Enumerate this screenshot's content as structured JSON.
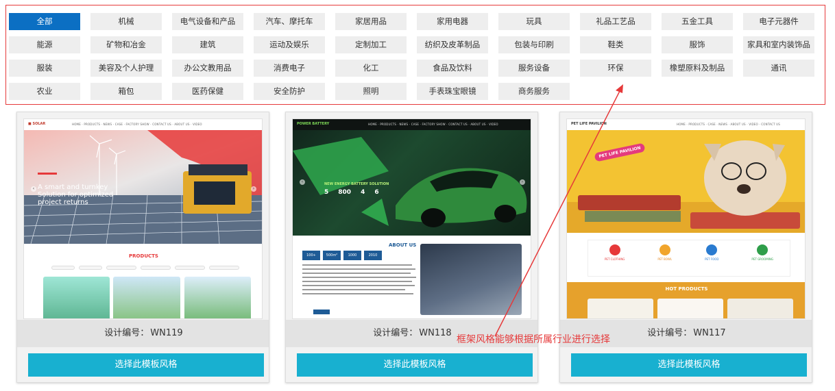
{
  "categories": {
    "active_index": 0,
    "items": [
      "全部",
      "机械",
      "电气设备和产品",
      "汽车、摩托车",
      "家居用品",
      "家用电器",
      "玩具",
      "礼品工艺品",
      "五金工具",
      "电子元器件",
      "能源",
      "矿物和冶金",
      "建筑",
      "运动及娱乐",
      "定制加工",
      "纺织及皮革制品",
      "包装与印刷",
      "鞋类",
      "服饰",
      "家具和室内装饰品",
      "服装",
      "美容及个人护理",
      "办公文教用品",
      "消费电子",
      "化工",
      "食品及饮料",
      "服务设备",
      "环保",
      "橡塑原料及制品",
      "通讯",
      "农业",
      "箱包",
      "医药保健",
      "安全防护",
      "照明",
      "手表珠宝眼镜",
      "商务服务"
    ]
  },
  "templates": [
    {
      "code_label": "设计编号：",
      "code": "WN119",
      "select_label": "选择此模板风格",
      "preview": {
        "hero_text": "A smart and turnkey Solution for optimized project returns",
        "section_title": "PRODUCTS",
        "accent": "#e6393a"
      }
    },
    {
      "code_label": "设计编号：",
      "code": "WN118",
      "select_label": "选择此模板风格",
      "preview": {
        "brand": "POWER BATTERY",
        "stats": [
          "5",
          "800",
          "4",
          "6"
        ],
        "section_title": "ABOUT US",
        "stat_boxes": [
          "100+",
          "500m²",
          "1000",
          "2010"
        ],
        "accent": "#1a9e3f"
      }
    },
    {
      "code_label": "设计编号：",
      "code": "WN117",
      "select_label": "选择此模板风格",
      "preview": {
        "brand": "PET LIFE PAVILION",
        "hero_badge": "PET LIFE PAVILION",
        "features": [
          "PET CLOTHING",
          "PET BOWL",
          "PET FOOD",
          "PET GROOMING"
        ],
        "section_title": "HOT PRODUCTS",
        "accent": "#f3c332"
      }
    }
  ],
  "annotation": {
    "text": "框架风格能够根据所属行业进行选择",
    "color": "#e6393a"
  }
}
